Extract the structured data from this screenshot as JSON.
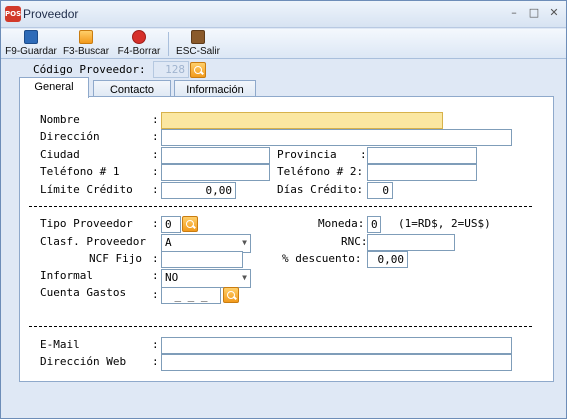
{
  "window": {
    "title": "Proveedor",
    "app_icon_text": "POS",
    "minimize": "–",
    "maximize": "□",
    "close": "✕"
  },
  "toolbar": {
    "save": {
      "label": "F9-Guardar",
      "icon": "floppy-icon",
      "color": "#2e6bb8"
    },
    "search": {
      "label": "F3-Buscar",
      "icon": "search-icon",
      "color": "#f29a1c"
    },
    "delete": {
      "label": "F4-Borrar",
      "icon": "delete-icon",
      "color": "#d6302b"
    },
    "exit": {
      "label": "ESC-Salir",
      "icon": "exit-door-icon",
      "color": "#8a5a2b"
    }
  },
  "header": {
    "codigo_label": "Código Proveedor:",
    "codigo_value": "128"
  },
  "tabs": [
    {
      "label": "General",
      "active": true
    },
    {
      "label": "Contacto",
      "active": false
    },
    {
      "label": "Información",
      "active": false
    }
  ],
  "form": {
    "colon": ":",
    "nombre": {
      "label": "Nombre",
      "value": ""
    },
    "direccion": {
      "label": "Dirección",
      "value": ""
    },
    "ciudad": {
      "label": "Ciudad",
      "value": ""
    },
    "provincia": {
      "label": "Provincia",
      "value": ""
    },
    "telefono1": {
      "label": "Teléfono # 1",
      "value": ""
    },
    "telefono2": {
      "label": "Teléfono # 2:",
      "value": ""
    },
    "limite_credito": {
      "label": "Límite Crédito",
      "value": "0,00"
    },
    "dias_credito": {
      "label": "Días Crédito:",
      "value": "0"
    },
    "separator": "------------------------------------------------------------------------",
    "tipo_proveedor": {
      "label": "Tipo Proveedor",
      "value": "0"
    },
    "moneda": {
      "label": "Moneda:",
      "value": "0",
      "hint": "(1=RD$, 2=US$)"
    },
    "clasf_proveedor": {
      "label": "Clasf. Proveedor",
      "value": "A"
    },
    "rnc": {
      "label": "RNC:",
      "value": ""
    },
    "ncf_fijo": {
      "label": "NCF Fijo",
      "value": ""
    },
    "descuento": {
      "label": "% descuento:",
      "value": "0,00"
    },
    "informal": {
      "label": "Informal",
      "value": "NO"
    },
    "cuenta_gastos": {
      "label": "Cuenta Gastos",
      "value": "_ _ _"
    },
    "email": {
      "label": "E-Mail",
      "value": ""
    },
    "web": {
      "label": "Dirección Web",
      "value": ""
    }
  }
}
